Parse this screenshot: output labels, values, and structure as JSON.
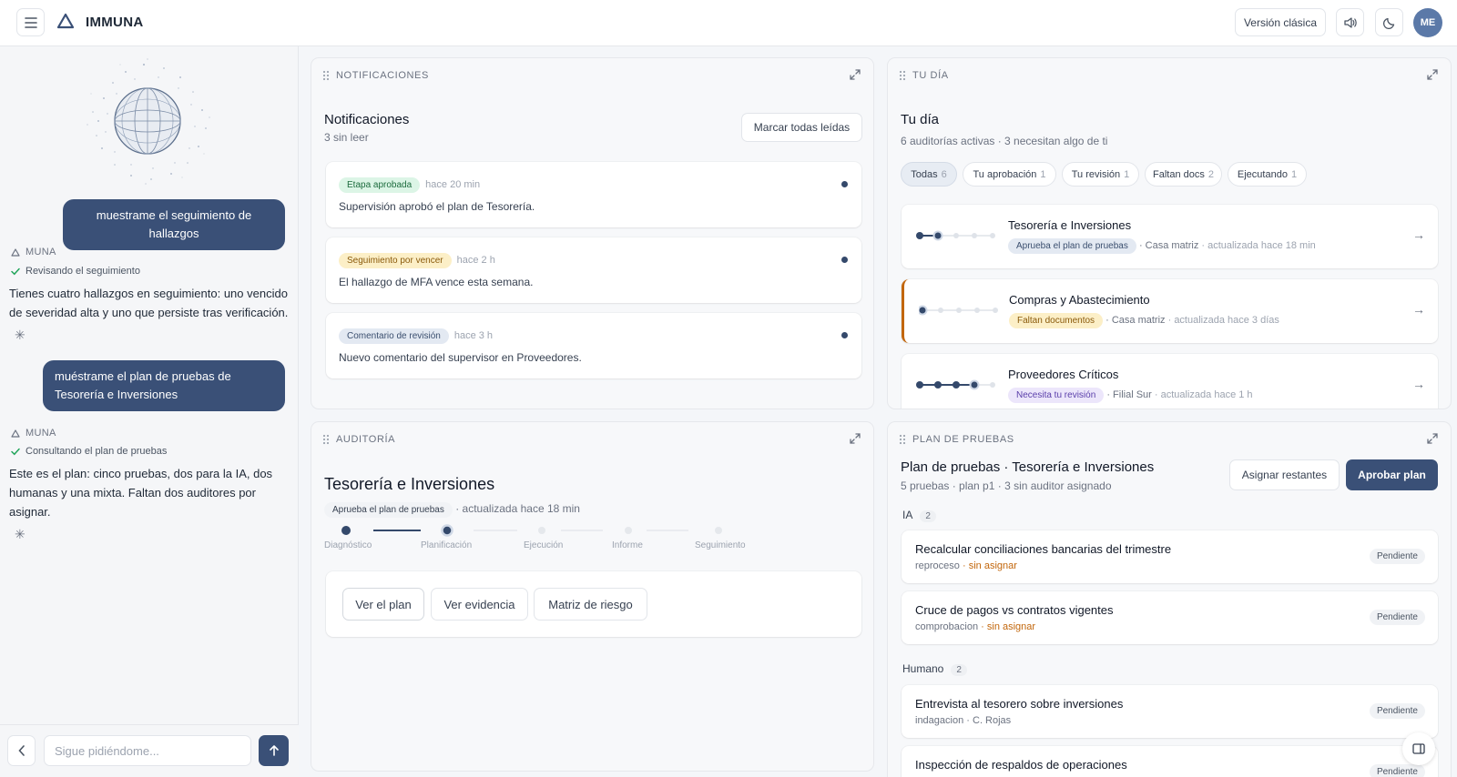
{
  "header": {
    "brand": "IMMUNA",
    "classic_label": "Versión clásica",
    "avatar_initials": "ME"
  },
  "sidebar": {
    "user_msg_1": "muestrame el seguimiento de hallazgos",
    "bot_1": {
      "label": "MUNA",
      "status": "Revisando el seguimiento",
      "text": "Tienes cuatro hallazgos en seguimiento: uno vencido de severidad alta y uno que persiste tras verificación."
    },
    "user_msg_2": "muéstrame el plan de pruebas de Tesorería e Inversiones",
    "bot_2": {
      "label": "MUNA",
      "status": "Consultando el plan de pruebas",
      "text": "Este es el plan: cinco pruebas, dos para la IA, dos humanas y una mixta. Faltan dos auditores por asignar."
    },
    "input_placeholder": "Sigue pidiéndome..."
  },
  "notifications": {
    "panel_label": "NOTIFICACIONES",
    "title": "Notificaciones",
    "subtitle": "3 sin leer",
    "mark_all_label": "Marcar todas leídas",
    "items": [
      {
        "badge": "Etapa aprobada",
        "time": "hace 20 min",
        "text": "Supervisión aprobó el plan de Tesorería."
      },
      {
        "badge": "Seguimiento por vencer",
        "time": "hace 2 h",
        "text": "El hallazgo de MFA vence esta semana."
      },
      {
        "badge": "Comentario de revisión",
        "time": "hace 3 h",
        "text": "Nuevo comentario del supervisor en Proveedores."
      }
    ]
  },
  "today": {
    "panel_label": "TU DÍA",
    "title": "Tu día",
    "subtitle": "6 auditorías activas · 3 necesitan algo de ti",
    "filters": [
      {
        "label": "Todas",
        "count": "6"
      },
      {
        "label": "Tu aprobación",
        "count": "1"
      },
      {
        "label": "Tu revisión",
        "count": "1"
      },
      {
        "label": "Faltan docs",
        "count": "2"
      },
      {
        "label": "Ejecutando",
        "count": "1"
      }
    ],
    "audits": [
      {
        "name": "Tesorería e Inversiones",
        "badge": "Aprueba el plan de pruebas",
        "location": "· Casa matriz",
        "updated": "· actualizada hace 18 min",
        "arrow": "→"
      },
      {
        "name": "Compras y Abastecimiento",
        "badge": "Faltan documentos",
        "location": "· Casa matriz",
        "updated": "· actualizada hace 3 días",
        "arrow": "→"
      },
      {
        "name": "Proveedores Críticos",
        "badge": "Necesita tu revisión",
        "location": "· Filial Sur",
        "updated": "· actualizada hace 1 h",
        "arrow": "→"
      }
    ]
  },
  "audit": {
    "panel_label": "AUDITORÍA",
    "title": "Tesorería e Inversiones",
    "badge": "Aprueba el plan de pruebas",
    "updated": "· actualizada hace 18 min",
    "steps": [
      "Diagnóstico",
      "Planificación",
      "Ejecución",
      "Informe",
      "Seguimiento"
    ],
    "current_step": 2,
    "buttons": [
      "Ver el plan",
      "Ver evidencia",
      "Matriz de riesgo"
    ]
  },
  "plan": {
    "panel_label": "PLAN DE PRUEBAS",
    "title": "Plan de pruebas · Tesorería e Inversiones",
    "subtitle": "5 pruebas · plan p1 · 3 sin auditor asignado",
    "assign_label": "Asignar restantes",
    "approve_label": "Aprobar plan",
    "group_ia": {
      "label": "IA",
      "count": "2"
    },
    "group_human": {
      "label": "Humano",
      "count": "2"
    },
    "tests": [
      {
        "title": "Recalcular conciliaciones bancarias del trimestre",
        "type": "reproceso",
        "assignee": "· sin asignar",
        "status": "Pendiente"
      },
      {
        "title": "Cruce de pagos vs contratos vigentes",
        "type": "comprobacion",
        "assignee": "· sin asignar",
        "status": "Pendiente"
      },
      {
        "title": "Entrevista al tesorero sobre inversiones",
        "type": "indagacion",
        "assignee": "· C. Rojas",
        "status": "Pendiente"
      },
      {
        "title": "Inspección de respaldos de operaciones",
        "type": "",
        "assignee": "",
        "status": "Pendiente"
      }
    ]
  }
}
